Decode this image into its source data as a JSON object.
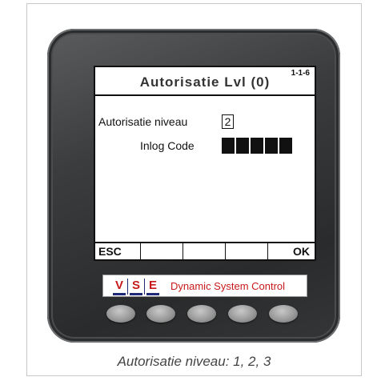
{
  "screen": {
    "title": "Autorisatie Lvl (0)",
    "code": "1-1-6",
    "level_label": "Autorisatie niveau",
    "level_value": "2",
    "login_label": "Inlog Code",
    "login_masked_chars": 5
  },
  "softkeys": [
    "ESC",
    "",
    "",
    "",
    "OK"
  ],
  "logo": {
    "letters": [
      "V",
      "S",
      "E"
    ],
    "text": "Dynamic System Control",
    "letter_color": "#c81a1a",
    "bar_color": "#1e2a78"
  },
  "hardware_buttons": 5,
  "caption": "Autorisatie niveau: 1, 2, 3"
}
